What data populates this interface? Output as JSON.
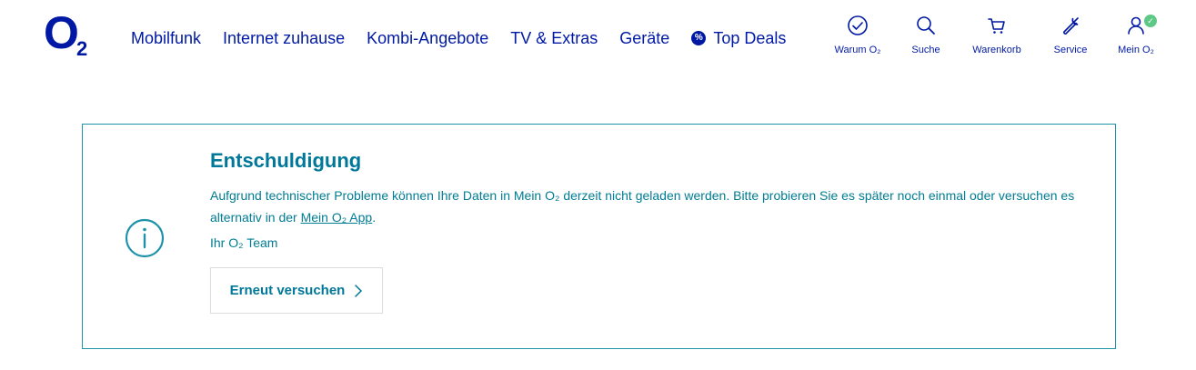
{
  "brand": {
    "logo_main": "O",
    "logo_sub": "2",
    "color": "#0019a5"
  },
  "nav": {
    "items": [
      {
        "label": "Mobilfunk"
      },
      {
        "label": "Internet zuhause"
      },
      {
        "label": "Kombi-Angebote"
      },
      {
        "label": "TV & Extras"
      },
      {
        "label": "Geräte"
      }
    ],
    "deals": {
      "label": "Top Deals",
      "badge": "%"
    }
  },
  "icon_nav": [
    {
      "label": "Warum O₂",
      "icon": "check-circle-icon"
    },
    {
      "label": "Suche",
      "icon": "search-icon"
    },
    {
      "label": "Warenkorb",
      "icon": "cart-icon"
    },
    {
      "label": "Service",
      "icon": "wrench-icon"
    },
    {
      "label": "Mein O₂",
      "icon": "user-icon",
      "status": "✓"
    }
  ],
  "alert": {
    "title": "Entschuldigung",
    "text": "Aufgrund technischer Probleme können Ihre Daten in Mein O₂ derzeit nicht geladen werden. Bitte probieren Sie es später noch einmal oder versuchen es alternativ in der ",
    "link": "Mein O₂ App",
    "text_end": ".",
    "signature": "Ihr O₂ Team",
    "button_label": "Erneut versuchen",
    "accent_color": "#1e93a8"
  }
}
